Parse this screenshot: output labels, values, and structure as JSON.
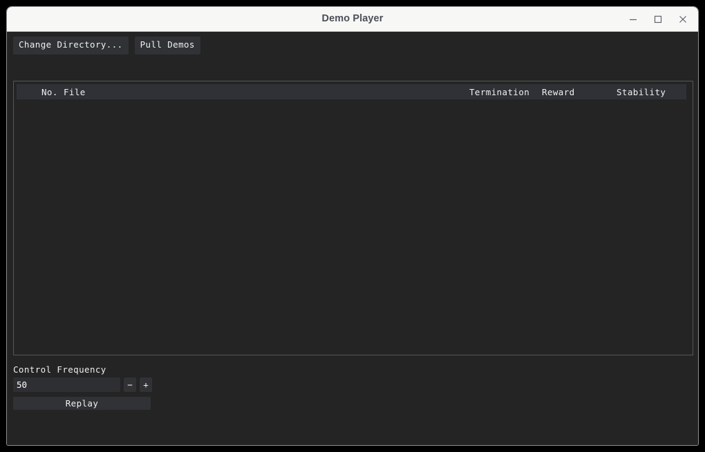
{
  "window": {
    "title": "Demo Player",
    "controls": {
      "minimize": "minimize",
      "maximize": "maximize",
      "close": "close"
    }
  },
  "toolbar": {
    "change_directory_label": "Change Directory...",
    "pull_demos_label": "Pull Demos"
  },
  "list": {
    "headers": {
      "no": "No.",
      "file": "File",
      "termination": "Termination",
      "reward": "Reward",
      "stability": "Stability"
    },
    "rows": []
  },
  "controls": {
    "frequency_label": "Control Frequency",
    "frequency_value": "50",
    "decrement_label": "−",
    "increment_label": "+",
    "replay_label": "Replay"
  },
  "colors": {
    "titlebar_bg": "#f7f7f6",
    "title_text": "#4a4f57",
    "window_bg": "#242424",
    "button_bg": "#303236",
    "header_row_bg": "#2f3136",
    "panel_border": "#555759",
    "text": "#f1f1f1"
  }
}
